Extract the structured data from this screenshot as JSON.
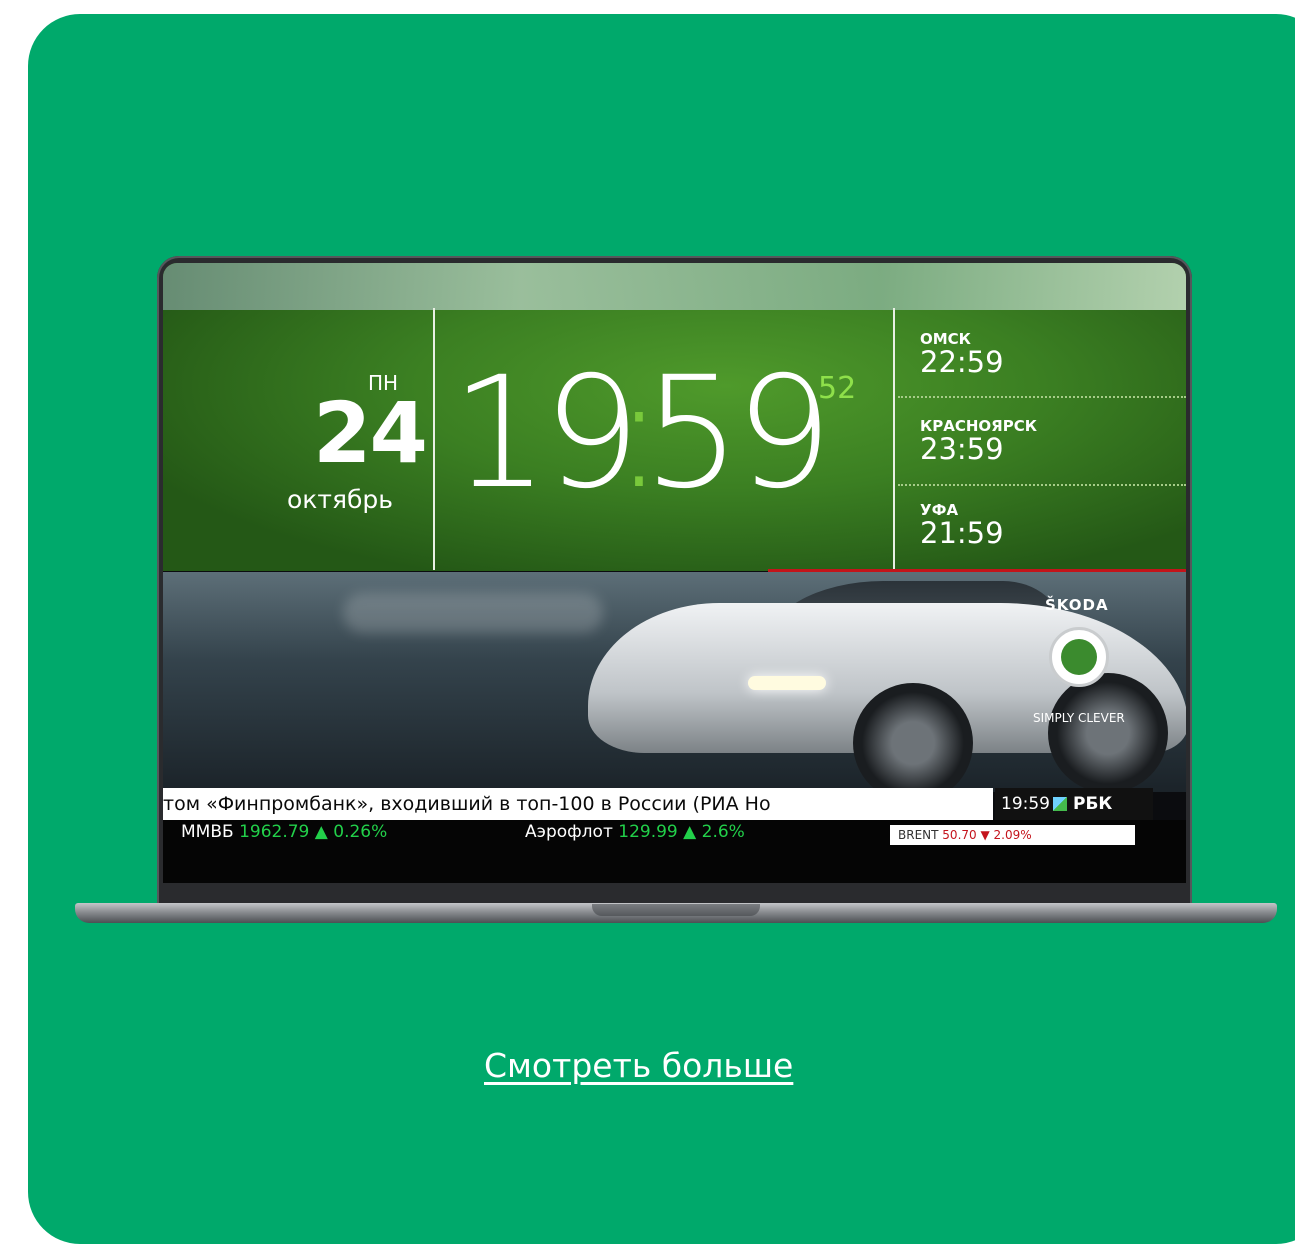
{
  "tv": {
    "day_abbr": "ПН",
    "day_number": "24",
    "month": "октябрь",
    "clock_hours": "19",
    "clock_colon": ":",
    "clock_minutes": "59",
    "clock_seconds": "52",
    "cities": [
      {
        "name": "ОМСК",
        "time": "22:59"
      },
      {
        "name": "КРАСНОЯРСК",
        "time": "23:59"
      },
      {
        "name": "УФА",
        "time": "21:59"
      }
    ],
    "ad": {
      "brand": "ŠKODA",
      "slogan": "SIMPLY CLEVER"
    },
    "ticker_headline": "том «Финпромбанк», входивший в топ-100 в России (РИА Но",
    "channel_time": "19:59",
    "channel_name": "РБК",
    "stocks": [
      {
        "name": "ММВБ",
        "value": "1962.79 ▲ 0.26%"
      },
      {
        "name": "Аэрофлот",
        "value": "129.99 ▲ 2.6%"
      }
    ],
    "brent": {
      "label": "BRENT",
      "value": "50.70",
      "change": "▼ 2.09%"
    }
  },
  "colors": {
    "card_bg": "#00a96b",
    "accent_green": "#79c93b"
  },
  "link": {
    "label": "Смотреть больше"
  }
}
